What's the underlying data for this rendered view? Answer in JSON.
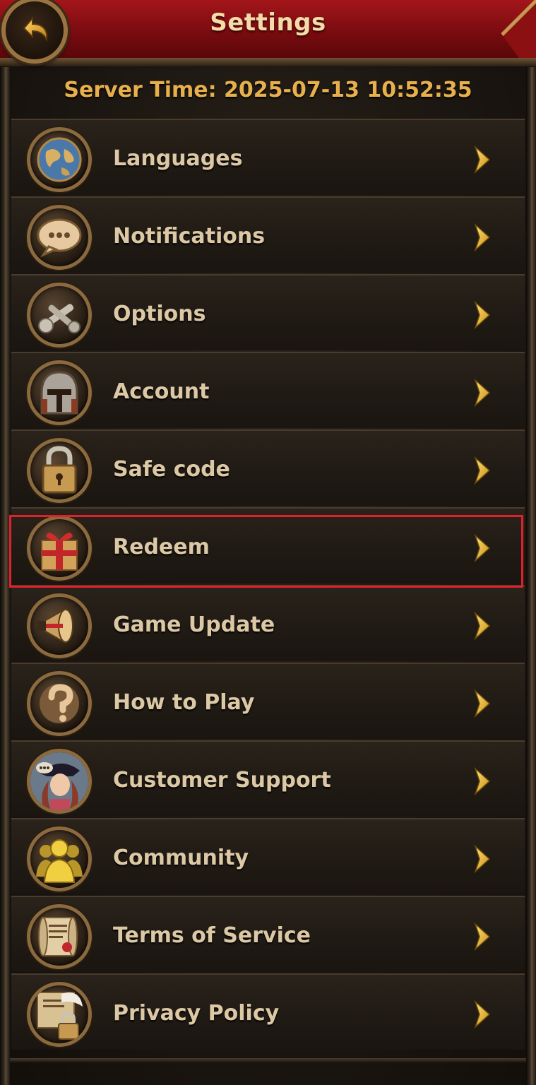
{
  "header": {
    "title": "Settings"
  },
  "server_time": "Server Time: 2025-07-13 10:52:35",
  "menu": [
    {
      "label": "Languages",
      "icon": "globe-icon"
    },
    {
      "label": "Notifications",
      "icon": "chat-bubble-icon"
    },
    {
      "label": "Options",
      "icon": "wrench-icon"
    },
    {
      "label": "Account",
      "icon": "helmet-icon"
    },
    {
      "label": "Safe code",
      "icon": "padlock-icon"
    },
    {
      "label": "Redeem",
      "icon": "gift-box-icon"
    },
    {
      "label": "Game Update",
      "icon": "megaphone-icon"
    },
    {
      "label": "How to Play",
      "icon": "question-mark-icon"
    },
    {
      "label": "Customer Support",
      "icon": "support-agent-icon"
    },
    {
      "label": "Community",
      "icon": "community-icon"
    },
    {
      "label": "Terms of Service",
      "icon": "scroll-icon"
    },
    {
      "label": "Privacy Policy",
      "icon": "document-lock-icon"
    }
  ],
  "colors": {
    "header_red": "#a3161a",
    "gold_text": "#e7b04d",
    "label_text": "#dcc8a4",
    "chevron_gold": "#f0c020",
    "highlight_red": "#e0212b"
  }
}
